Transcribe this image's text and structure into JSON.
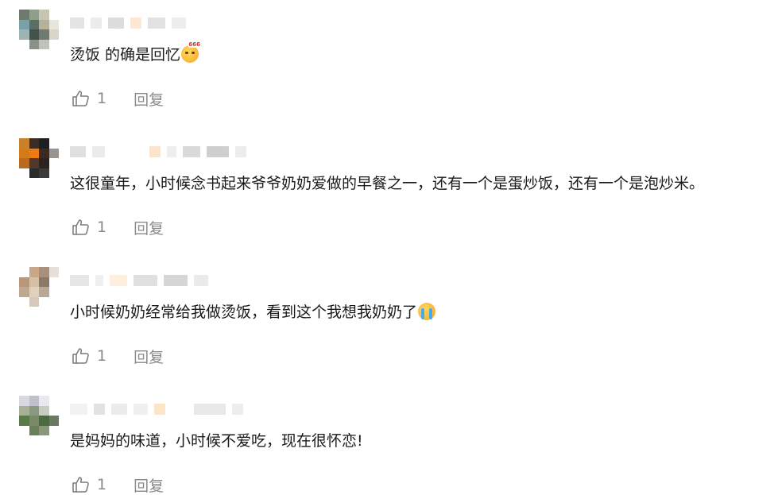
{
  "comments": [
    {
      "text": "烫饭 的确是回忆",
      "emoji": "thinking-face-666-emoji",
      "emoji_badge": "666",
      "likes": "1",
      "reply_label": "回复",
      "avatar_colors": [
        "#6e7a6e",
        "#8fa08a",
        "#c8c4b0",
        "#ffffff",
        "#7aa0a8",
        "#5c6d66",
        "#b6b29a",
        "#e8e6dc",
        "#9fb3b3",
        "#44524d",
        "#707a70",
        "#d8d6c8",
        "#ffffff",
        "#8a9288",
        "#c0c4b8",
        "#ffffff"
      ]
    },
    {
      "text": "这很童年，小时候念书起来爷爷奶奶爱做的早餐之一，还有一个是蛋炒饭，还有一个是泡炒米。",
      "emoji": "",
      "emoji_badge": "",
      "likes": "1",
      "reply_label": "回复",
      "avatar_colors": [
        "#c9812c",
        "#3d2c22",
        "#1f1f1f",
        "#ffffff",
        "#d47a18",
        "#f07a10",
        "#3a2a20",
        "#9a9490",
        "#b86a24",
        "#50382a",
        "#2a2420",
        "#ffffff",
        "#ffffff",
        "#2a2a2a",
        "#3a3a3a",
        "#ffffff"
      ]
    },
    {
      "text": "小时候奶奶经常给我做烫饭，看到这个我想我奶奶了",
      "emoji": "crying-face-emoji",
      "emoji_badge": "",
      "likes": "1",
      "reply_label": "回复",
      "avatar_colors": [
        "#ffffff",
        "#c8a888",
        "#a8907a",
        "#e8e0d8",
        "#b89878",
        "#d8c0a8",
        "#8a7868",
        "#ffffff",
        "#c0a890",
        "#e0d0c0",
        "#b8a898",
        "#ffffff",
        "#ffffff",
        "#d8c8b8",
        "#ffffff",
        "#ffffff"
      ]
    },
    {
      "text": "是妈妈的味道，小时候不爱吃，现在很怀恋!",
      "emoji": "",
      "emoji_badge": "",
      "likes": "1",
      "reply_label": "回复",
      "avatar_colors": [
        "#d8d8e0",
        "#c0c0cc",
        "#e8e8ee",
        "#ffffff",
        "#a8b098",
        "#8a9a80",
        "#c8ccc0",
        "#ffffff",
        "#5a7a48",
        "#7a8a68",
        "#4a6a40",
        "#6a7a60",
        "#ffffff",
        "#6a8058",
        "#8a9878",
        "#ffffff"
      ]
    }
  ]
}
